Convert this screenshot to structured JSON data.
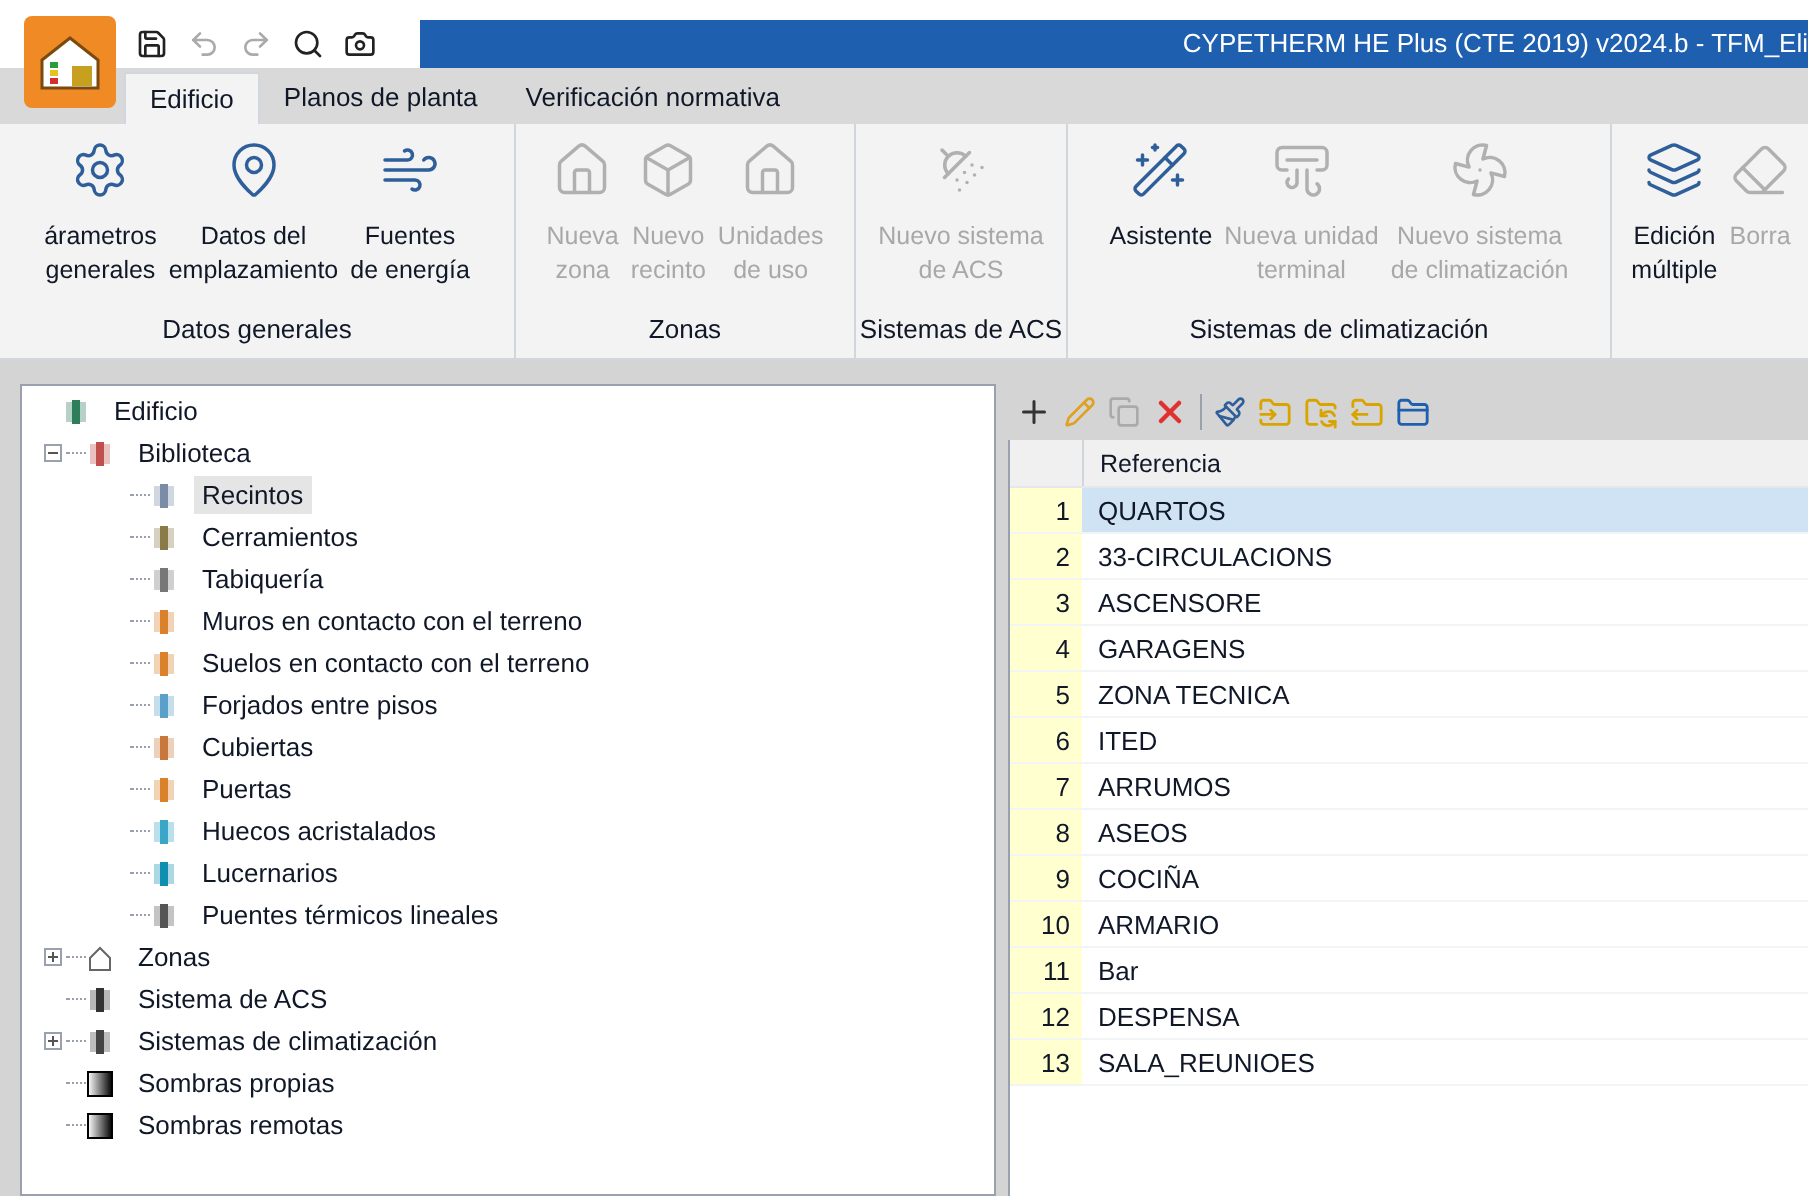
{
  "window": {
    "title": "CYPETHERM HE Plus (CTE 2019) v2024.b - TFM_Eli"
  },
  "tabs": [
    {
      "label": "Edificio",
      "selected": true
    },
    {
      "label": "Planos de planta",
      "selected": false
    },
    {
      "label": "Verificación normativa",
      "selected": false
    }
  ],
  "ribbon_groups": [
    {
      "label": "Datos generales",
      "buttons": [
        {
          "kind": "gear",
          "lines": [
            "árametros",
            "generales"
          ],
          "disabled": false
        },
        {
          "kind": "pin",
          "lines": [
            "Datos del",
            "emplazamiento"
          ],
          "disabled": false
        },
        {
          "kind": "wind",
          "lines": [
            "Fuentes",
            "de energía"
          ],
          "disabled": false
        }
      ]
    },
    {
      "label": "Zonas",
      "buttons": [
        {
          "kind": "house",
          "lines": [
            "Nueva",
            "zona"
          ],
          "disabled": true
        },
        {
          "kind": "box",
          "lines": [
            "Nuevo",
            "recinto"
          ],
          "disabled": true
        },
        {
          "kind": "house",
          "lines": [
            "Unidades",
            "de uso"
          ],
          "disabled": true
        }
      ]
    },
    {
      "label": "Sistemas de ACS",
      "buttons": [
        {
          "kind": "shower",
          "lines": [
            "Nuevo sistema",
            "de ACS"
          ],
          "disabled": true
        }
      ]
    },
    {
      "label": "Sistemas de climatización",
      "buttons": [
        {
          "kind": "wizard",
          "lines": [
            "Asistente"
          ],
          "disabled": false
        },
        {
          "kind": "unit",
          "lines": [
            "Nueva unidad",
            "terminal"
          ],
          "disabled": true
        },
        {
          "kind": "fan",
          "lines": [
            "Nuevo sistema",
            "de climatización"
          ],
          "disabled": true
        }
      ]
    },
    {
      "buttons": [
        {
          "kind": "multi",
          "lines": [
            "Edición",
            "múltiple"
          ],
          "disabled": false
        },
        {
          "kind": "eraser",
          "lines": [
            "Borra"
          ],
          "disabled": true
        }
      ]
    }
  ],
  "tree": [
    {
      "label": "Edificio",
      "kind": "building",
      "selected": false,
      "children": [
        {
          "label": "Biblioteca",
          "kind": "books",
          "selected": false,
          "expanded": true,
          "children": [
            {
              "label": "Recintos",
              "kind": "room",
              "selected": true
            },
            {
              "label": "Cerramientos",
              "kind": "wall",
              "selected": false
            },
            {
              "label": "Tabiquería",
              "kind": "partition",
              "selected": false
            },
            {
              "label": "Muros en contacto con el terreno",
              "kind": "wall-ground",
              "selected": false
            },
            {
              "label": "Suelos en contacto con el terreno",
              "kind": "floor",
              "selected": false
            },
            {
              "label": "Forjados entre pisos",
              "kind": "slab",
              "selected": false
            },
            {
              "label": "Cubiertas",
              "kind": "roof",
              "selected": false
            },
            {
              "label": "Puertas",
              "kind": "door",
              "selected": false
            },
            {
              "label": "Huecos acristalados",
              "kind": "window",
              "selected": false
            },
            {
              "label": "Lucernarios",
              "kind": "skylight",
              "selected": false
            },
            {
              "label": "Puentes térmicos lineales",
              "kind": "bridge",
              "selected": false
            }
          ]
        },
        {
          "label": "Zonas",
          "kind": "zone",
          "selected": false,
          "expanded": false
        },
        {
          "label": "Sistema de ACS",
          "kind": "tap",
          "selected": false
        },
        {
          "label": "Sistemas de climatización",
          "kind": "hvac",
          "selected": false,
          "expanded": false
        },
        {
          "label": "Sombras propias",
          "kind": "shade",
          "selected": false
        },
        {
          "label": "Sombras remotas",
          "kind": "shade",
          "selected": false
        }
      ]
    }
  ],
  "table": {
    "columns": [
      "Referencia"
    ],
    "rows": [
      {
        "num": "1",
        "ref": "QUARTOS",
        "selected": true
      },
      {
        "num": "2",
        "ref": "33-CIRCULACIONS",
        "selected": false
      },
      {
        "num": "3",
        "ref": "ASCENSORE",
        "selected": false
      },
      {
        "num": "4",
        "ref": "GARAGENS",
        "selected": false
      },
      {
        "num": "5",
        "ref": "ZONA TECNICA",
        "selected": false
      },
      {
        "num": "6",
        "ref": "ITED",
        "selected": false
      },
      {
        "num": "7",
        "ref": "ARRUMOS",
        "selected": false
      },
      {
        "num": "8",
        "ref": "ASEOS",
        "selected": false
      },
      {
        "num": "9",
        "ref": "COCIÑA",
        "selected": false
      },
      {
        "num": "10",
        "ref": "ARMARIO",
        "selected": false
      },
      {
        "num": "11",
        "ref": "Bar",
        "selected": false
      },
      {
        "num": "12",
        "ref": "DESPENSA",
        "selected": false
      },
      {
        "num": "13",
        "ref": "SALA_REUNIOES",
        "selected": false
      }
    ]
  }
}
